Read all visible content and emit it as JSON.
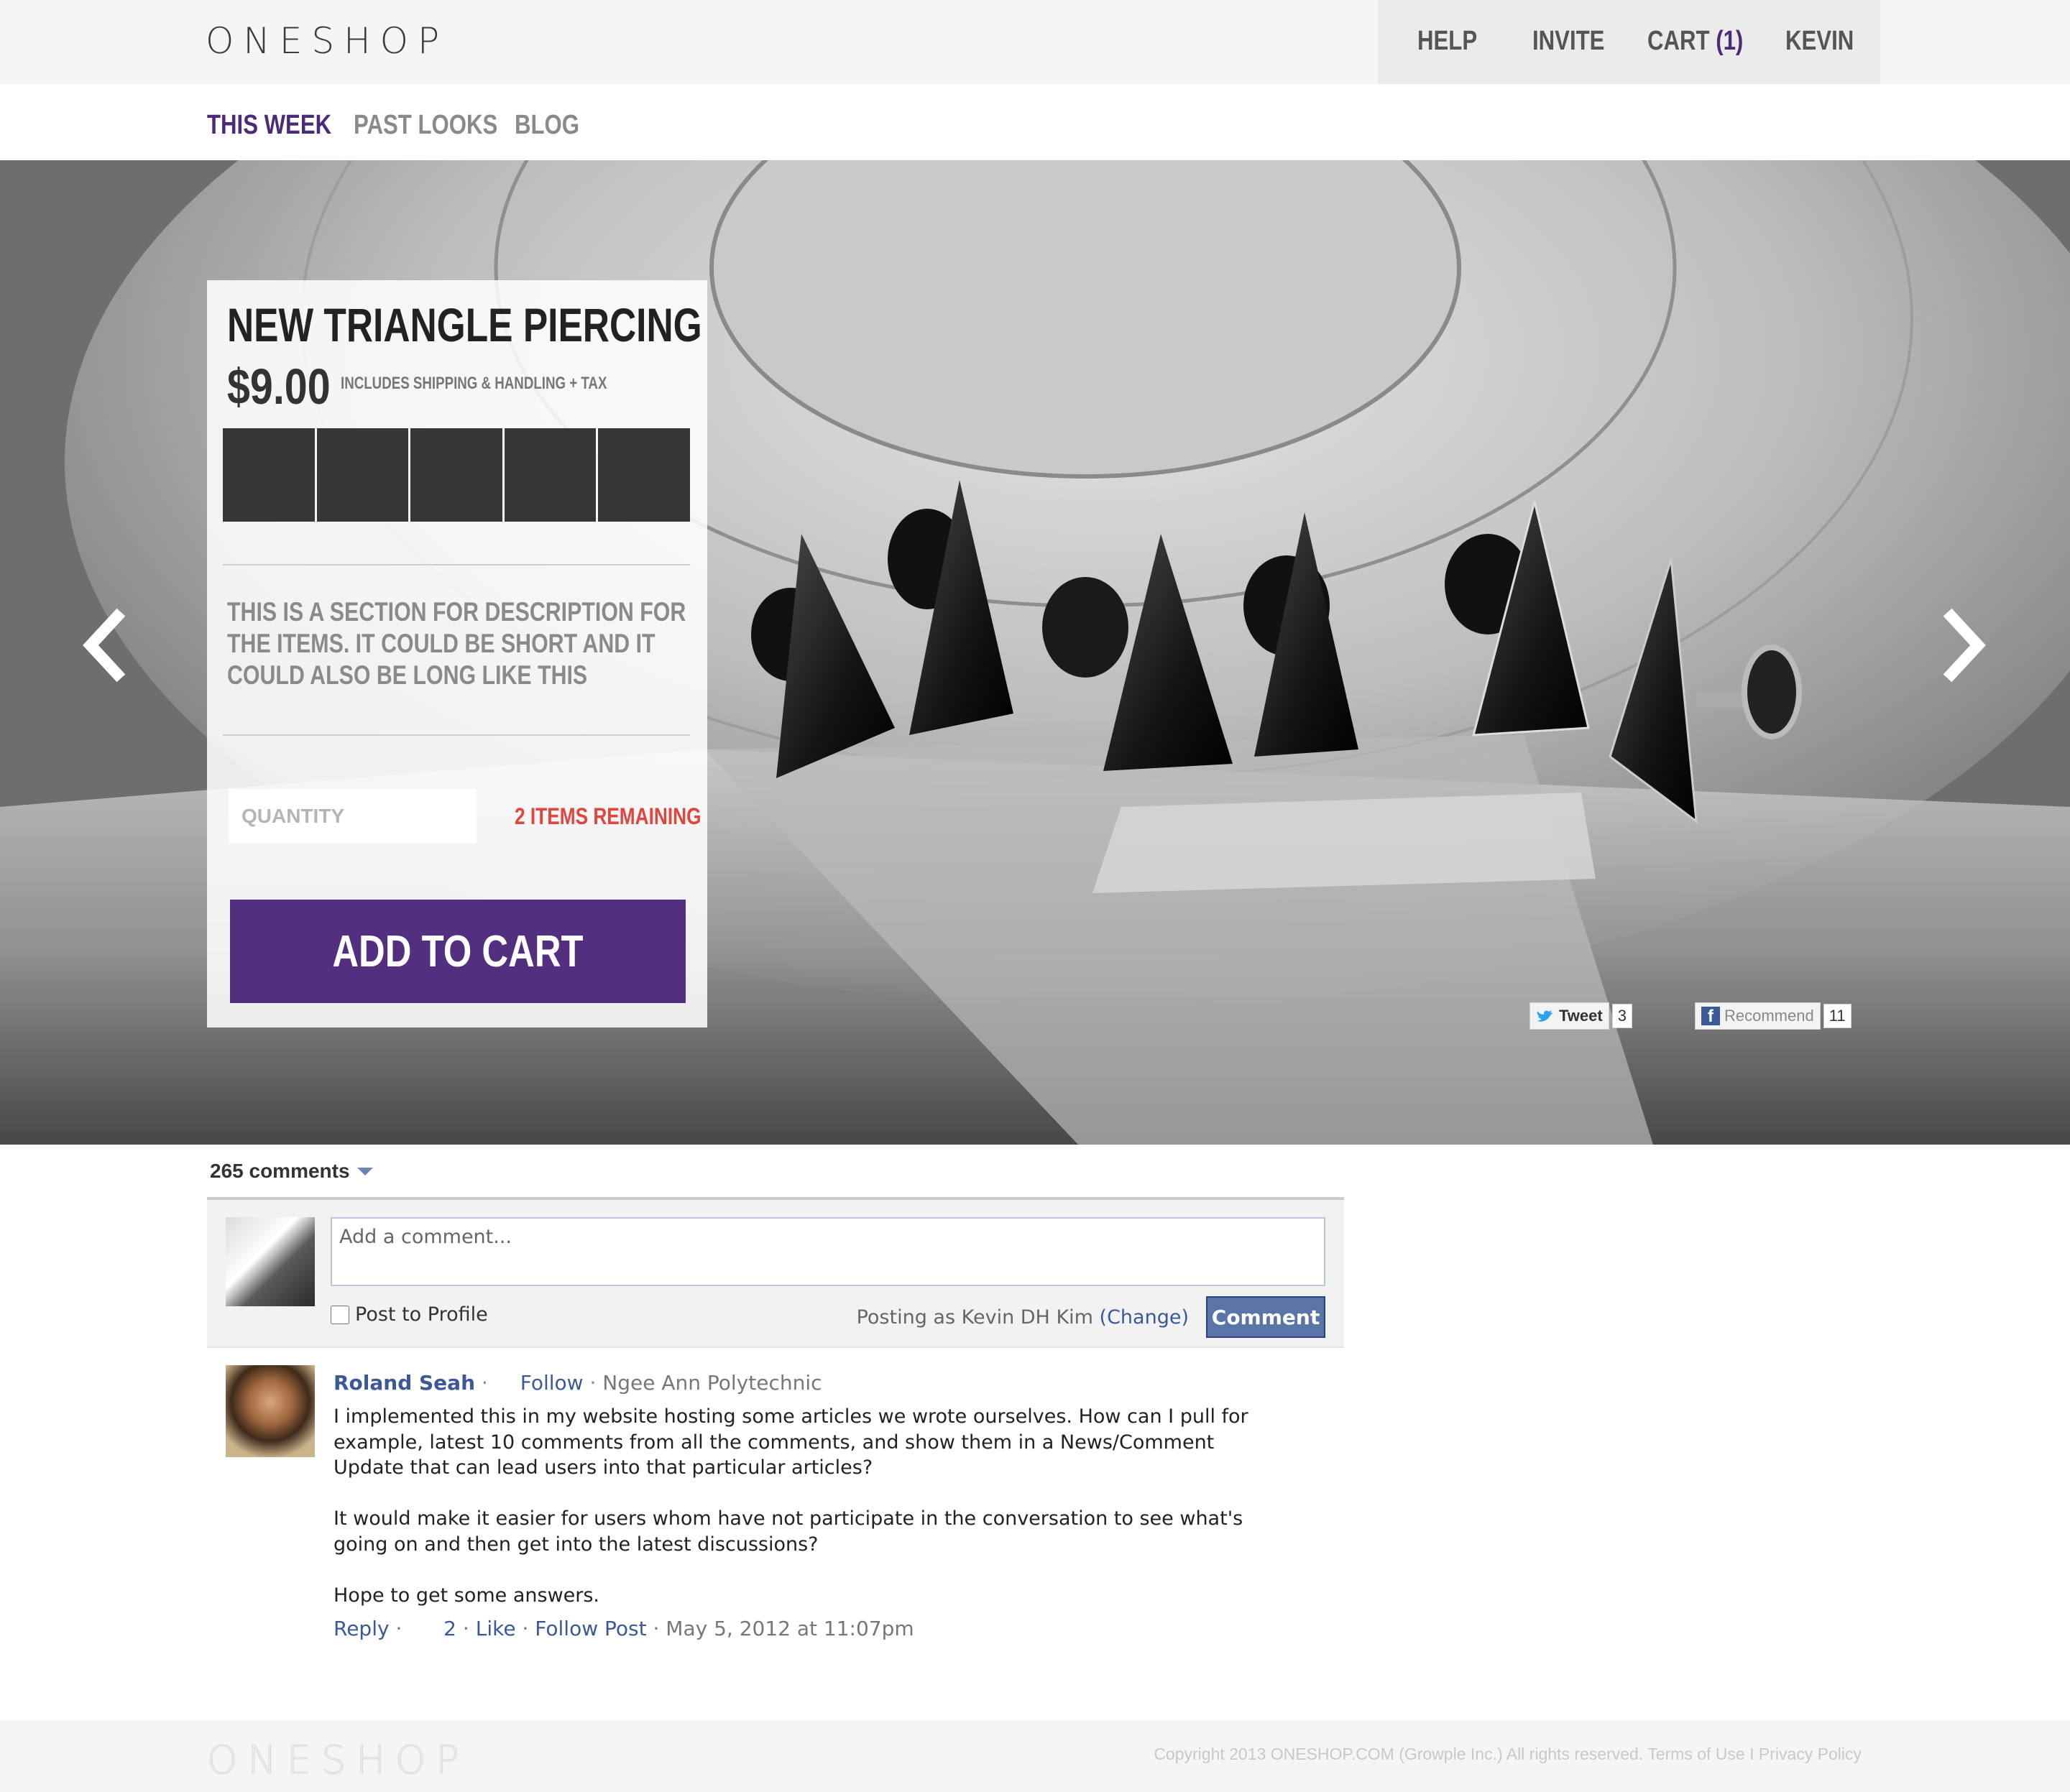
{
  "header": {
    "logo": "ONESHOP",
    "nav": {
      "help": "HELP",
      "invite": "INVITE",
      "cart": "CART",
      "cart_count": "(1)",
      "user": "KEVIN"
    },
    "subnav": {
      "this_week": "THIS WEEK",
      "past_looks": "PAST LOOKS",
      "blog": "BLOG"
    }
  },
  "product": {
    "title": "NEW TRIANGLE PIERCING",
    "price": "$9.00",
    "price_note": "INCLUDES SHIPPING & HANDLING + TAX",
    "swatch_count": 5,
    "description": "THIS IS A SECTION FOR DESCRIPTION FOR THE ITEMS. IT COULD BE SHORT AND IT COULD ALSO BE LONG LIKE THIS",
    "quantity_placeholder": "QUANTITY",
    "remaining": "2 ITEMS REMAINING",
    "add_to_cart": "ADD TO CART"
  },
  "social": {
    "tweet_label": "Tweet",
    "tweet_count": "3",
    "recommend_label": "Recommend",
    "recommend_count": "11"
  },
  "comments": {
    "count_label": "265 comments",
    "composer": {
      "placeholder": "Add a comment...",
      "post_to_profile": "Post to Profile",
      "posting_as": "Posting as Kevin DH Kim",
      "change": "(Change)",
      "submit": "Comment"
    },
    "items": [
      {
        "author": "Roland Seah",
        "follow": "Follow",
        "affiliation": "Ngee Ann Polytechnic",
        "paragraphs": [
          "I implemented this in my website hosting some articles we wrote ourselves. How can I pull for example, latest 10 comments from all the comments, and show them in a News/Comment Update that can lead users into that particular articles?",
          "It would make it easier for users whom have not participate in the conversation to see what's going on and then get into the latest discussions?",
          "Hope to get some answers."
        ],
        "reply": "Reply",
        "likes": "2",
        "like": "Like",
        "follow_post": "Follow Post",
        "timestamp": "May 5, 2012 at 11:07pm"
      }
    ]
  },
  "footer": {
    "logo": "ONESHOP",
    "copyright": "Copyright 2013 ONESHOP.COM (Growple Inc.) All rights reserved.",
    "terms": "Terms of Use",
    "separator": "I",
    "privacy": "Privacy Policy"
  },
  "colors": {
    "brand_purple": "#53307f",
    "alert_red": "#e0453e",
    "facebook_blue": "#3b5998"
  }
}
